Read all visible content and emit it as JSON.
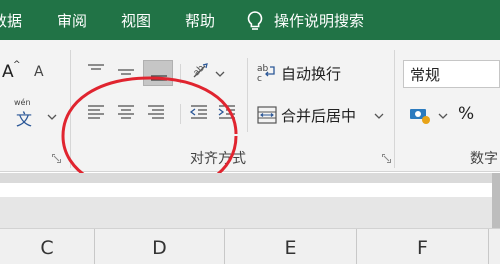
{
  "tabs": [
    {
      "label": "数据"
    },
    {
      "label": "审阅"
    },
    {
      "label": "视图"
    },
    {
      "label": "帮助"
    }
  ],
  "tell_me": "操作说明搜索",
  "icons": {
    "tell_me": "lightbulb-icon",
    "wrap": "wrap-text-icon",
    "merge": "merge-center-icon",
    "currency": "accounting-format-icon"
  },
  "alignment": {
    "wrap_text": "自动换行",
    "merge_center": "合并后居中",
    "group_label": "对齐方式",
    "font_size_up": "A",
    "font_size_down": "A",
    "phonetic_top": "wén",
    "phonetic_char": "文"
  },
  "number": {
    "format": "常规",
    "percent": "%",
    "group_label": "数字"
  },
  "columns": [
    "C",
    "D",
    "E",
    "F"
  ],
  "colors": {
    "accent": "#217346",
    "ribbon_bg": "#f3f3f3",
    "highlight_circle": "#e0242f"
  }
}
